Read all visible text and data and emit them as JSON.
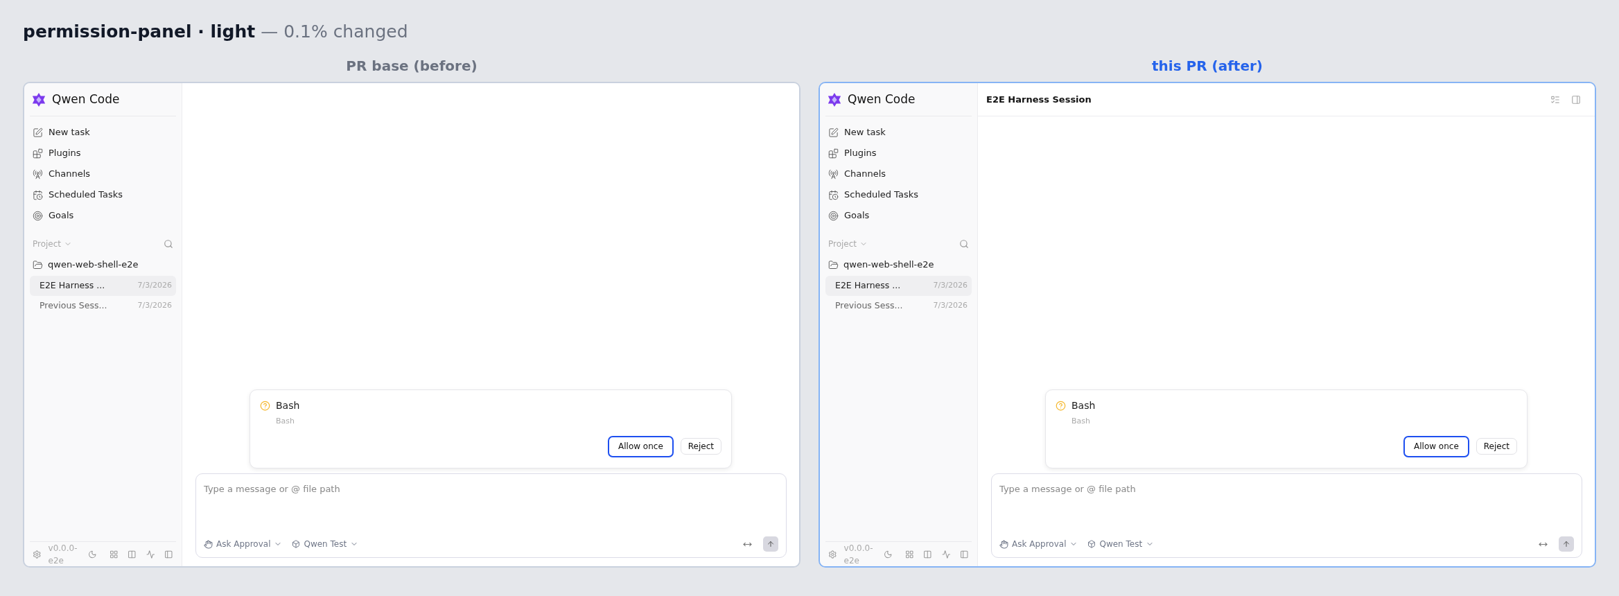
{
  "heading": {
    "title": "permission-panel · light",
    "note": "— 0.1% changed"
  },
  "panels": [
    {
      "caption": "PR base (before)",
      "kind": "before",
      "app": {
        "name": "Qwen Code",
        "nav": [
          {
            "label": "New task",
            "kind": "new"
          },
          {
            "label": "Plugins",
            "kind": "plugins"
          },
          {
            "label": "Channels",
            "kind": "channels"
          },
          {
            "label": "Scheduled Tasks",
            "kind": "scheduled"
          },
          {
            "label": "Goals",
            "kind": "goals"
          }
        ],
        "section": "Project",
        "folder": "qwen-web-shell-e2e",
        "sessions": [
          {
            "title": "E2E Harness ...",
            "date": "7/3/2026",
            "selected": true
          },
          {
            "title": "Previous Sess...",
            "date": "7/3/2026",
            "selected": false
          }
        ],
        "version": "v0.0.0-e2e",
        "permission": {
          "title": "Bash",
          "subtitle": "Bash",
          "buttons": [
            {
              "label": "Allow once",
              "focused": true
            },
            {
              "label": "Reject",
              "focused": false
            }
          ]
        },
        "composer": {
          "placeholder": "Type a message or @ file path",
          "mode": "Ask Approval",
          "model": "Qwen Test"
        }
      }
    },
    {
      "caption": "this PR (after)",
      "kind": "after",
      "header": {
        "title": "E2E Harness Session"
      },
      "app": {
        "name": "Qwen Code",
        "nav": [
          {
            "label": "New task",
            "kind": "new"
          },
          {
            "label": "Plugins",
            "kind": "plugins"
          },
          {
            "label": "Channels",
            "kind": "channels"
          },
          {
            "label": "Scheduled Tasks",
            "kind": "scheduled"
          },
          {
            "label": "Goals",
            "kind": "goals"
          }
        ],
        "section": "Project",
        "folder": "qwen-web-shell-e2e",
        "sessions": [
          {
            "title": "E2E Harness ...",
            "date": "7/3/2026",
            "selected": true
          },
          {
            "title": "Previous Sess...",
            "date": "7/3/2026",
            "selected": false
          }
        ],
        "version": "v0.0.0-e2e",
        "permission": {
          "title": "Bash",
          "subtitle": "Bash",
          "buttons": [
            {
              "label": "Allow once",
              "focused": true
            },
            {
              "label": "Reject",
              "focused": false
            }
          ]
        },
        "composer": {
          "placeholder": "Type a message or @ file path",
          "mode": "Ask Approval",
          "model": "Qwen Test"
        }
      }
    }
  ]
}
